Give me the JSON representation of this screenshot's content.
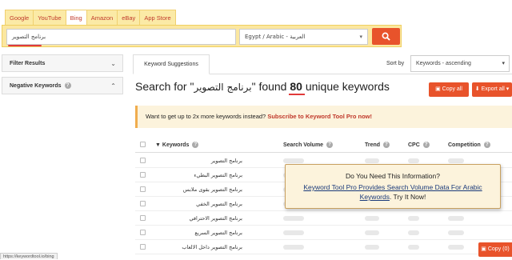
{
  "tabs": [
    "Google",
    "YouTube",
    "Bing",
    "Amazon",
    "eBay",
    "App Store"
  ],
  "search": {
    "value": "برنامج التصوير",
    "language": "Egypt / Arabic - العربية"
  },
  "sidebar": {
    "filter_results": "Filter Results",
    "negative_keywords": "Negative Keywords"
  },
  "main": {
    "tab_label": "Keyword Suggestions",
    "sort_by_label": "Sort by",
    "sort_value": "Keywords - ascending",
    "heading_prefix": "Search for \"",
    "heading_query": "برنامج التصوير",
    "heading_middle": "\" found",
    "heading_count": "80",
    "heading_suffix": "unique keywords",
    "copy_all": "Copy all",
    "export_all": "Export all"
  },
  "promo": {
    "text": "Want to get up to 2x more keywords instead?",
    "link": "Subscribe to Keyword Tool Pro now!"
  },
  "table": {
    "headers": {
      "keywords": "Keywords",
      "search_volume": "Search Volume",
      "trend": "Trend",
      "cpc": "CPC",
      "competition": "Competition"
    },
    "rows": [
      "برنامج التصوير",
      "برنامج التصوير البطيء",
      "برنامج التصوير بقوى ملابس",
      "برنامج التصوير الخفي",
      "برنامج التصوير الاحترافي",
      "برنامج التصوير السريع",
      "برنامج التصوير داخل الالعاب"
    ]
  },
  "overlay": {
    "title": "Do You Need This Information?",
    "line1": "Keyword Tool Pro Provides Search Volume Data For Arabic",
    "line2_link": "Keywords",
    "line2_rest": ". Try It Now!"
  },
  "status_url": "https://keywordtool.io/bing",
  "copy_button": "Copy (0)",
  "colors": {
    "accent": "#e8532b",
    "tab_bg": "#fbeaa6",
    "promo_bg": "#fcf3dc"
  }
}
